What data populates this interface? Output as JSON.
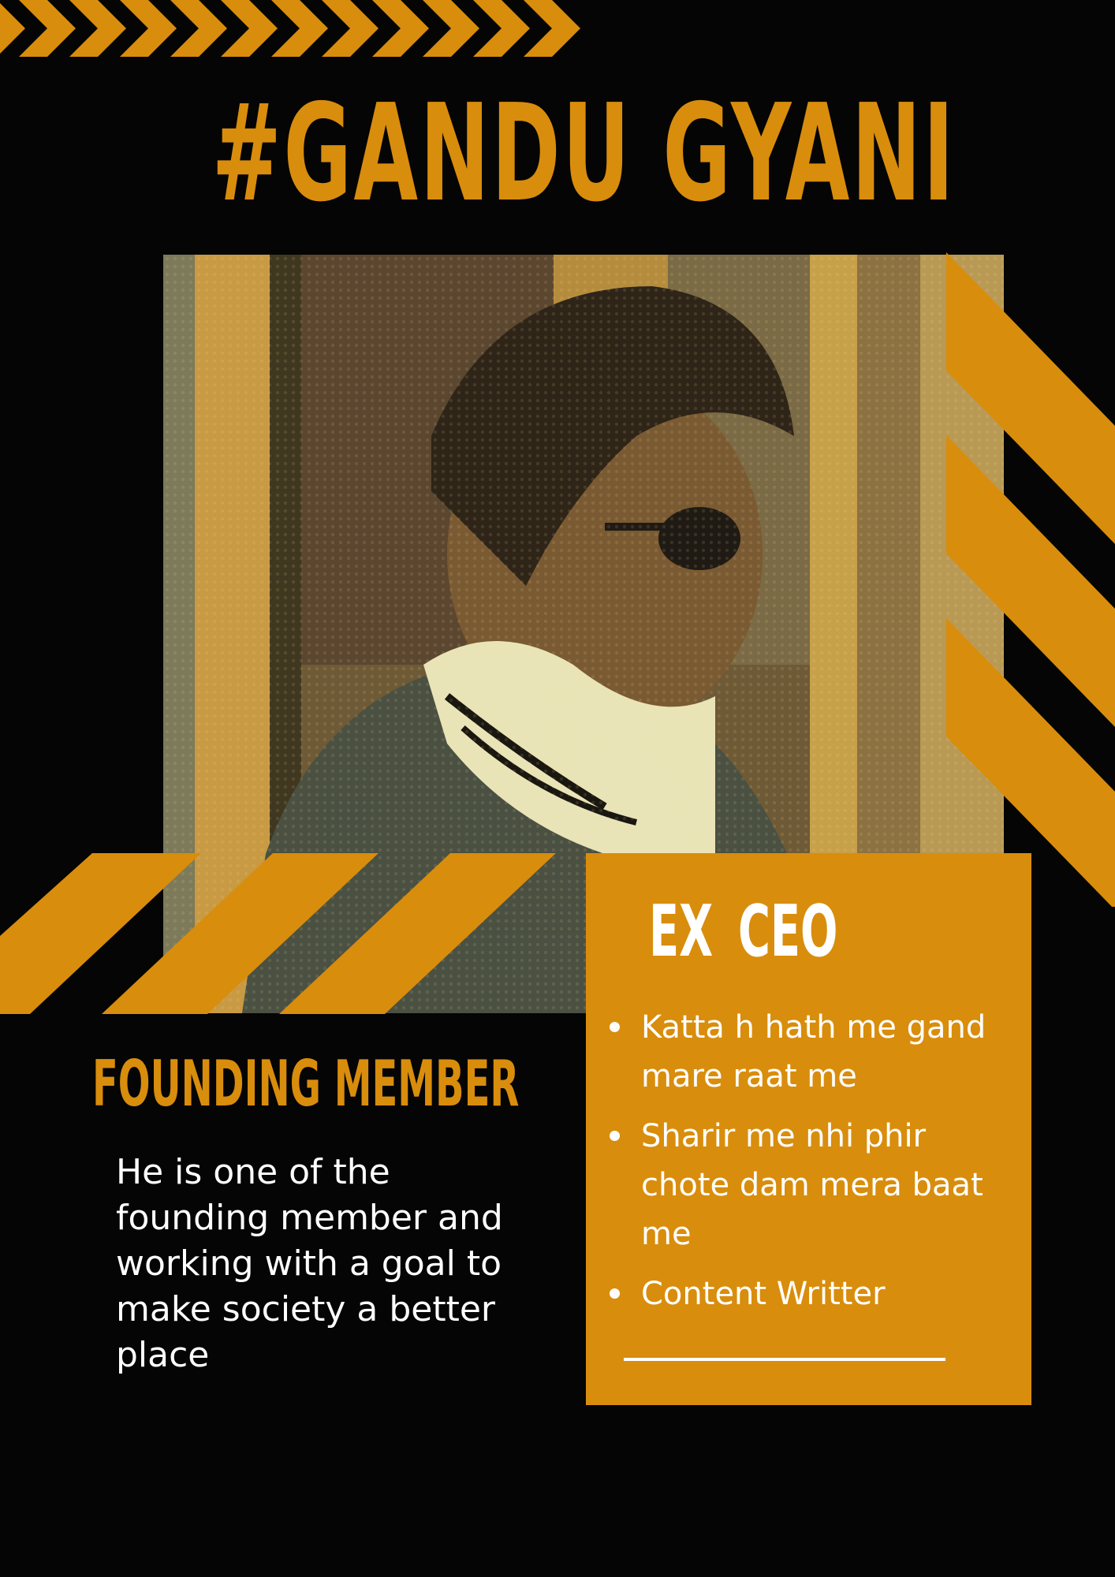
{
  "title": "#GANDU GYANI",
  "role": {
    "heading": "EX  CEO",
    "points": [
      "Katta h hath me gand mare raat me",
      "Sharir me nhi phir chote dam mera baat me",
      "Content Writter"
    ]
  },
  "founding": {
    "heading": "FOUNDING MEMBER",
    "description": "He is one of the founding member and working with a goal to make society a better place"
  },
  "colors": {
    "accent": "#D98D0C",
    "background": "#050505",
    "text_light": "#FFFFFF"
  }
}
